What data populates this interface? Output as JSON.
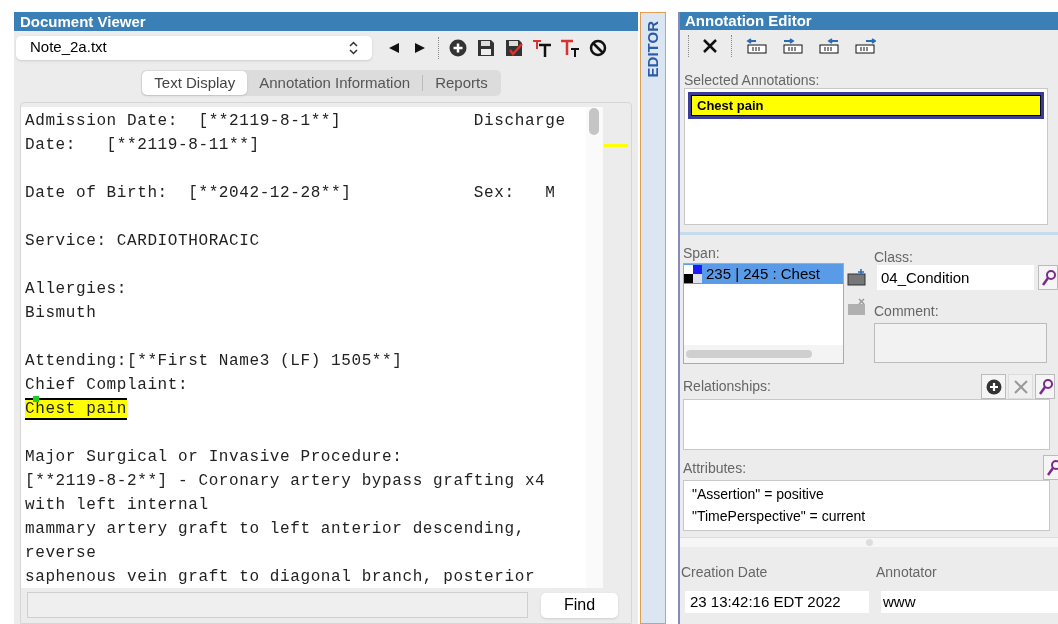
{
  "document_viewer": {
    "title": "Document Viewer",
    "file_select": {
      "value": "Note_2a.txt"
    },
    "tabs": [
      {
        "label": "Text Display",
        "selected": true
      },
      {
        "label": "Annotation Information",
        "selected": false
      },
      {
        "label": "Reports",
        "selected": false
      }
    ],
    "paragraphs": [
      {
        "lines": [
          {
            "text": "Admission Date:  [**2119-8-1**]             Discharge",
            "annotated": false
          },
          {
            "text": "Date:   [**2119-8-11**]",
            "annotated": false
          }
        ]
      },
      {
        "lines": [
          {
            "text": "Date of Birth:  [**2042-12-28**]            Sex:   M",
            "annotated": false
          }
        ]
      },
      {
        "lines": [
          {
            "text": "Service: CARDIOTHORACIC",
            "annotated": false
          }
        ]
      },
      {
        "lines": [
          {
            "text": "Allergies:",
            "annotated": false
          },
          {
            "text": "Bismuth",
            "annotated": false
          }
        ]
      },
      {
        "lines": [
          {
            "text": "Attending:[**First Name3 (LF) 1505**]",
            "annotated": false
          },
          {
            "text": "Chief Complaint:",
            "annotated": false
          },
          {
            "text": "Chest pain",
            "annotated": true
          }
        ]
      },
      {
        "lines": [
          {
            "text": "Major Surgical or Invasive Procedure:",
            "annotated": false
          },
          {
            "text": "[**2119-8-2**] - Coronary artery bypass grafting x4",
            "annotated": false
          },
          {
            "text": "with left internal",
            "annotated": false
          },
          {
            "text": "mammary artery graft to left anterior descending,",
            "annotated": false
          },
          {
            "text": "reverse",
            "annotated": false
          },
          {
            "text": "saphenous vein graft to diagonal branch, posterior",
            "annotated": false
          }
        ]
      }
    ],
    "find": {
      "button": "Find"
    }
  },
  "side_tab": {
    "label": "EDITOR"
  },
  "annotation_editor": {
    "title": "Annotation Editor",
    "selected_annotations": {
      "label": "Selected Annotations:",
      "items": [
        {
          "text": "Chest pain",
          "selected": true
        }
      ]
    },
    "span": {
      "label": "Span:",
      "items": [
        {
          "text": "235 | 245 : Chest",
          "selected": true
        }
      ]
    },
    "class": {
      "label": "Class:",
      "value": "04_Condition"
    },
    "comment": {
      "label": "Comment:"
    },
    "relationships": {
      "label": "Relationships:"
    },
    "attributes": {
      "label": "Attributes:",
      "items": [
        "\"Assertion\" = positive",
        "\"TimePerspective\" = current"
      ]
    },
    "creation_date": {
      "label": "Creation Date",
      "value": "23 13:42:16 EDT 2022"
    },
    "annotator": {
      "label": "Annotator",
      "value": "www"
    }
  }
}
